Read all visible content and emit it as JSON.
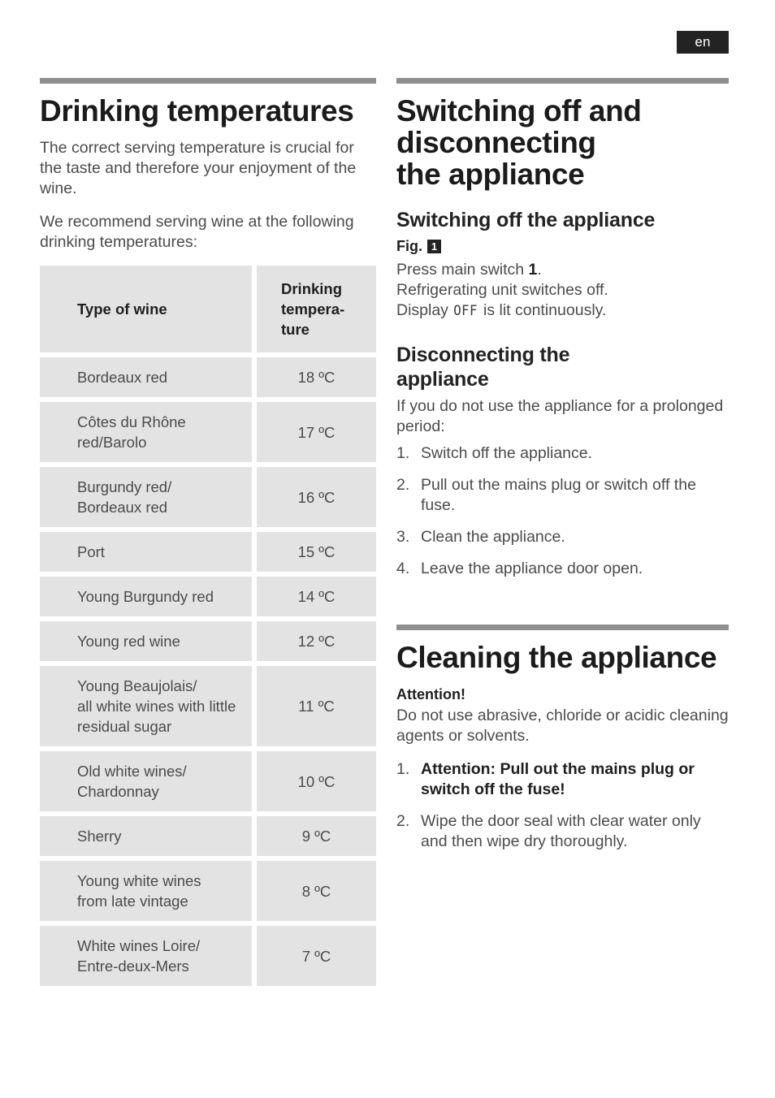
{
  "language_badge": "en",
  "left_column": {
    "heading": "Drinking temperatures",
    "paragraph_1": "The correct serving temperature is crucial for the taste and therefore your enjoyment of the wine.",
    "paragraph_2": "We recommend serving wine at the following drinking temperatures:",
    "table": {
      "headers": {
        "type": "Type of wine",
        "temperature_lines": [
          "Drinking",
          "tempera-",
          "ture"
        ]
      },
      "rows": [
        {
          "name_lines": [
            "Bordeaux red"
          ],
          "temperature": "18 ºC"
        },
        {
          "name_lines": [
            "Côtes du Rhône",
            "red/Barolo"
          ],
          "temperature": "17 ºC"
        },
        {
          "name_lines": [
            "Burgundy red/",
            "Bordeaux red"
          ],
          "temperature": "16 ºC"
        },
        {
          "name_lines": [
            "Port"
          ],
          "temperature": "15 ºC"
        },
        {
          "name_lines": [
            "Young Burgundy red"
          ],
          "temperature": "14 ºC"
        },
        {
          "name_lines": [
            "Young red wine"
          ],
          "temperature": "12 ºC"
        },
        {
          "name_lines": [
            "Young Beaujolais/",
            "all white wines with little",
            "residual sugar"
          ],
          "temperature": "11 ºC"
        },
        {
          "name_lines": [
            "Old white wines/",
            "Chardonnay"
          ],
          "temperature": "10 ºC"
        },
        {
          "name_lines": [
            "Sherry"
          ],
          "temperature": "9 ºC"
        },
        {
          "name_lines": [
            "Young white wines",
            "from late vintage"
          ],
          "temperature": "8 ºC"
        },
        {
          "name_lines": [
            "White wines Loire/",
            "Entre-deux-Mers"
          ],
          "temperature": "7 ºC"
        }
      ]
    }
  },
  "right_column": {
    "section_1": {
      "heading_lines": [
        "Switching off and",
        "disconnecting",
        "the appliance"
      ],
      "subheading": "Switching off the appliance",
      "fig_label": "Fig.",
      "fig_number": "1",
      "instruction_line_1_prefix": "Press main switch ",
      "instruction_line_1_bold": "1",
      "instruction_line_1_suffix": ".",
      "instruction_line_2": "Refrigerating unit switches off.",
      "instruction_line_3_prefix": "Display ",
      "instruction_line_3_lcd": "OFF",
      "instruction_line_3_suffix": " is lit continuously.",
      "disconnect_heading_lines": [
        "Disconnecting the",
        "appliance"
      ],
      "disconnect_intro": "If you do not use the appliance for a prolonged  period:",
      "disconnect_steps": [
        {
          "number": "1.",
          "text": "Switch off  the appliance.",
          "bold": false
        },
        {
          "number": "2.",
          "text": "Pull out the mains plug or switch off the fuse.",
          "bold": false
        },
        {
          "number": "3.",
          "text": "Clean  the  appliance.",
          "bold": false
        },
        {
          "number": "4.",
          "text": "Leave the appliance door  open.",
          "bold": false
        }
      ]
    },
    "section_2": {
      "heading": "Cleaning the appliance",
      "attention_label": "Attention!",
      "attention_text": "Do not use abrasive, chloride or acidic cleaning agents or solvents.",
      "steps": [
        {
          "number": "1.",
          "text": "Attention: Pull out the mains plug or switch off the fuse!",
          "bold": true
        },
        {
          "number": "2.",
          "text": "Wipe the door seal with clear water only and then wipe dry thoroughly.",
          "bold": false
        }
      ]
    }
  }
}
